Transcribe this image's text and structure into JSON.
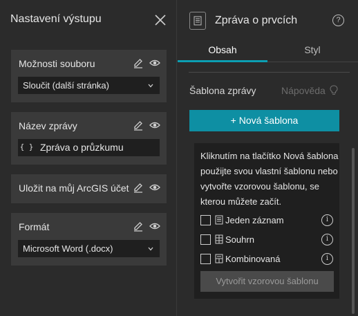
{
  "left_panel": {
    "title": "Nastavení výstupu",
    "cards": [
      {
        "title": "Možnosti souboru",
        "select_value": "Sloučit (další stránka)"
      },
      {
        "title": "Název zprávy",
        "prefix": "{ }",
        "input_value": "Zpráva o průzkumu"
      },
      {
        "title": "Uložit na můj ArcGIS účet"
      },
      {
        "title": "Formát",
        "select_value": "Microsoft Word (.docx)"
      }
    ],
    "icons": {
      "edit": "pencil-icon",
      "visibility": "eye-icon",
      "close": "close-icon",
      "dropdown": "chevron-down-icon"
    }
  },
  "right_panel": {
    "title": "Zpráva o prvcích",
    "help": "?",
    "tabs": [
      {
        "label": "Obsah",
        "active": true
      },
      {
        "label": "Styl",
        "active": false
      }
    ],
    "template_label": "Šablona zprávy",
    "help_link": "Nápověda",
    "new_template_button": "+  Nová šablona",
    "info_text": "Kliknutím na tlačítko Nová šablona použijte svou vlastní šablonu nebo vytvořte vzorovou šablonu, se kterou můžete začít.",
    "options": [
      {
        "label": "Jeden záznam",
        "checked": false
      },
      {
        "label": "Souhrn",
        "checked": false
      },
      {
        "label": "Kombinovaná",
        "checked": false
      }
    ],
    "create_button": "Vytvořit vzorovou šablonu",
    "info_icon_glyph": "i"
  },
  "colors": {
    "accent": "#0e8fa3",
    "tab_underline": "#0c9fb3",
    "background": "#2b2b2b",
    "card": "#3a3a3a",
    "field": "#1f1f1f"
  }
}
